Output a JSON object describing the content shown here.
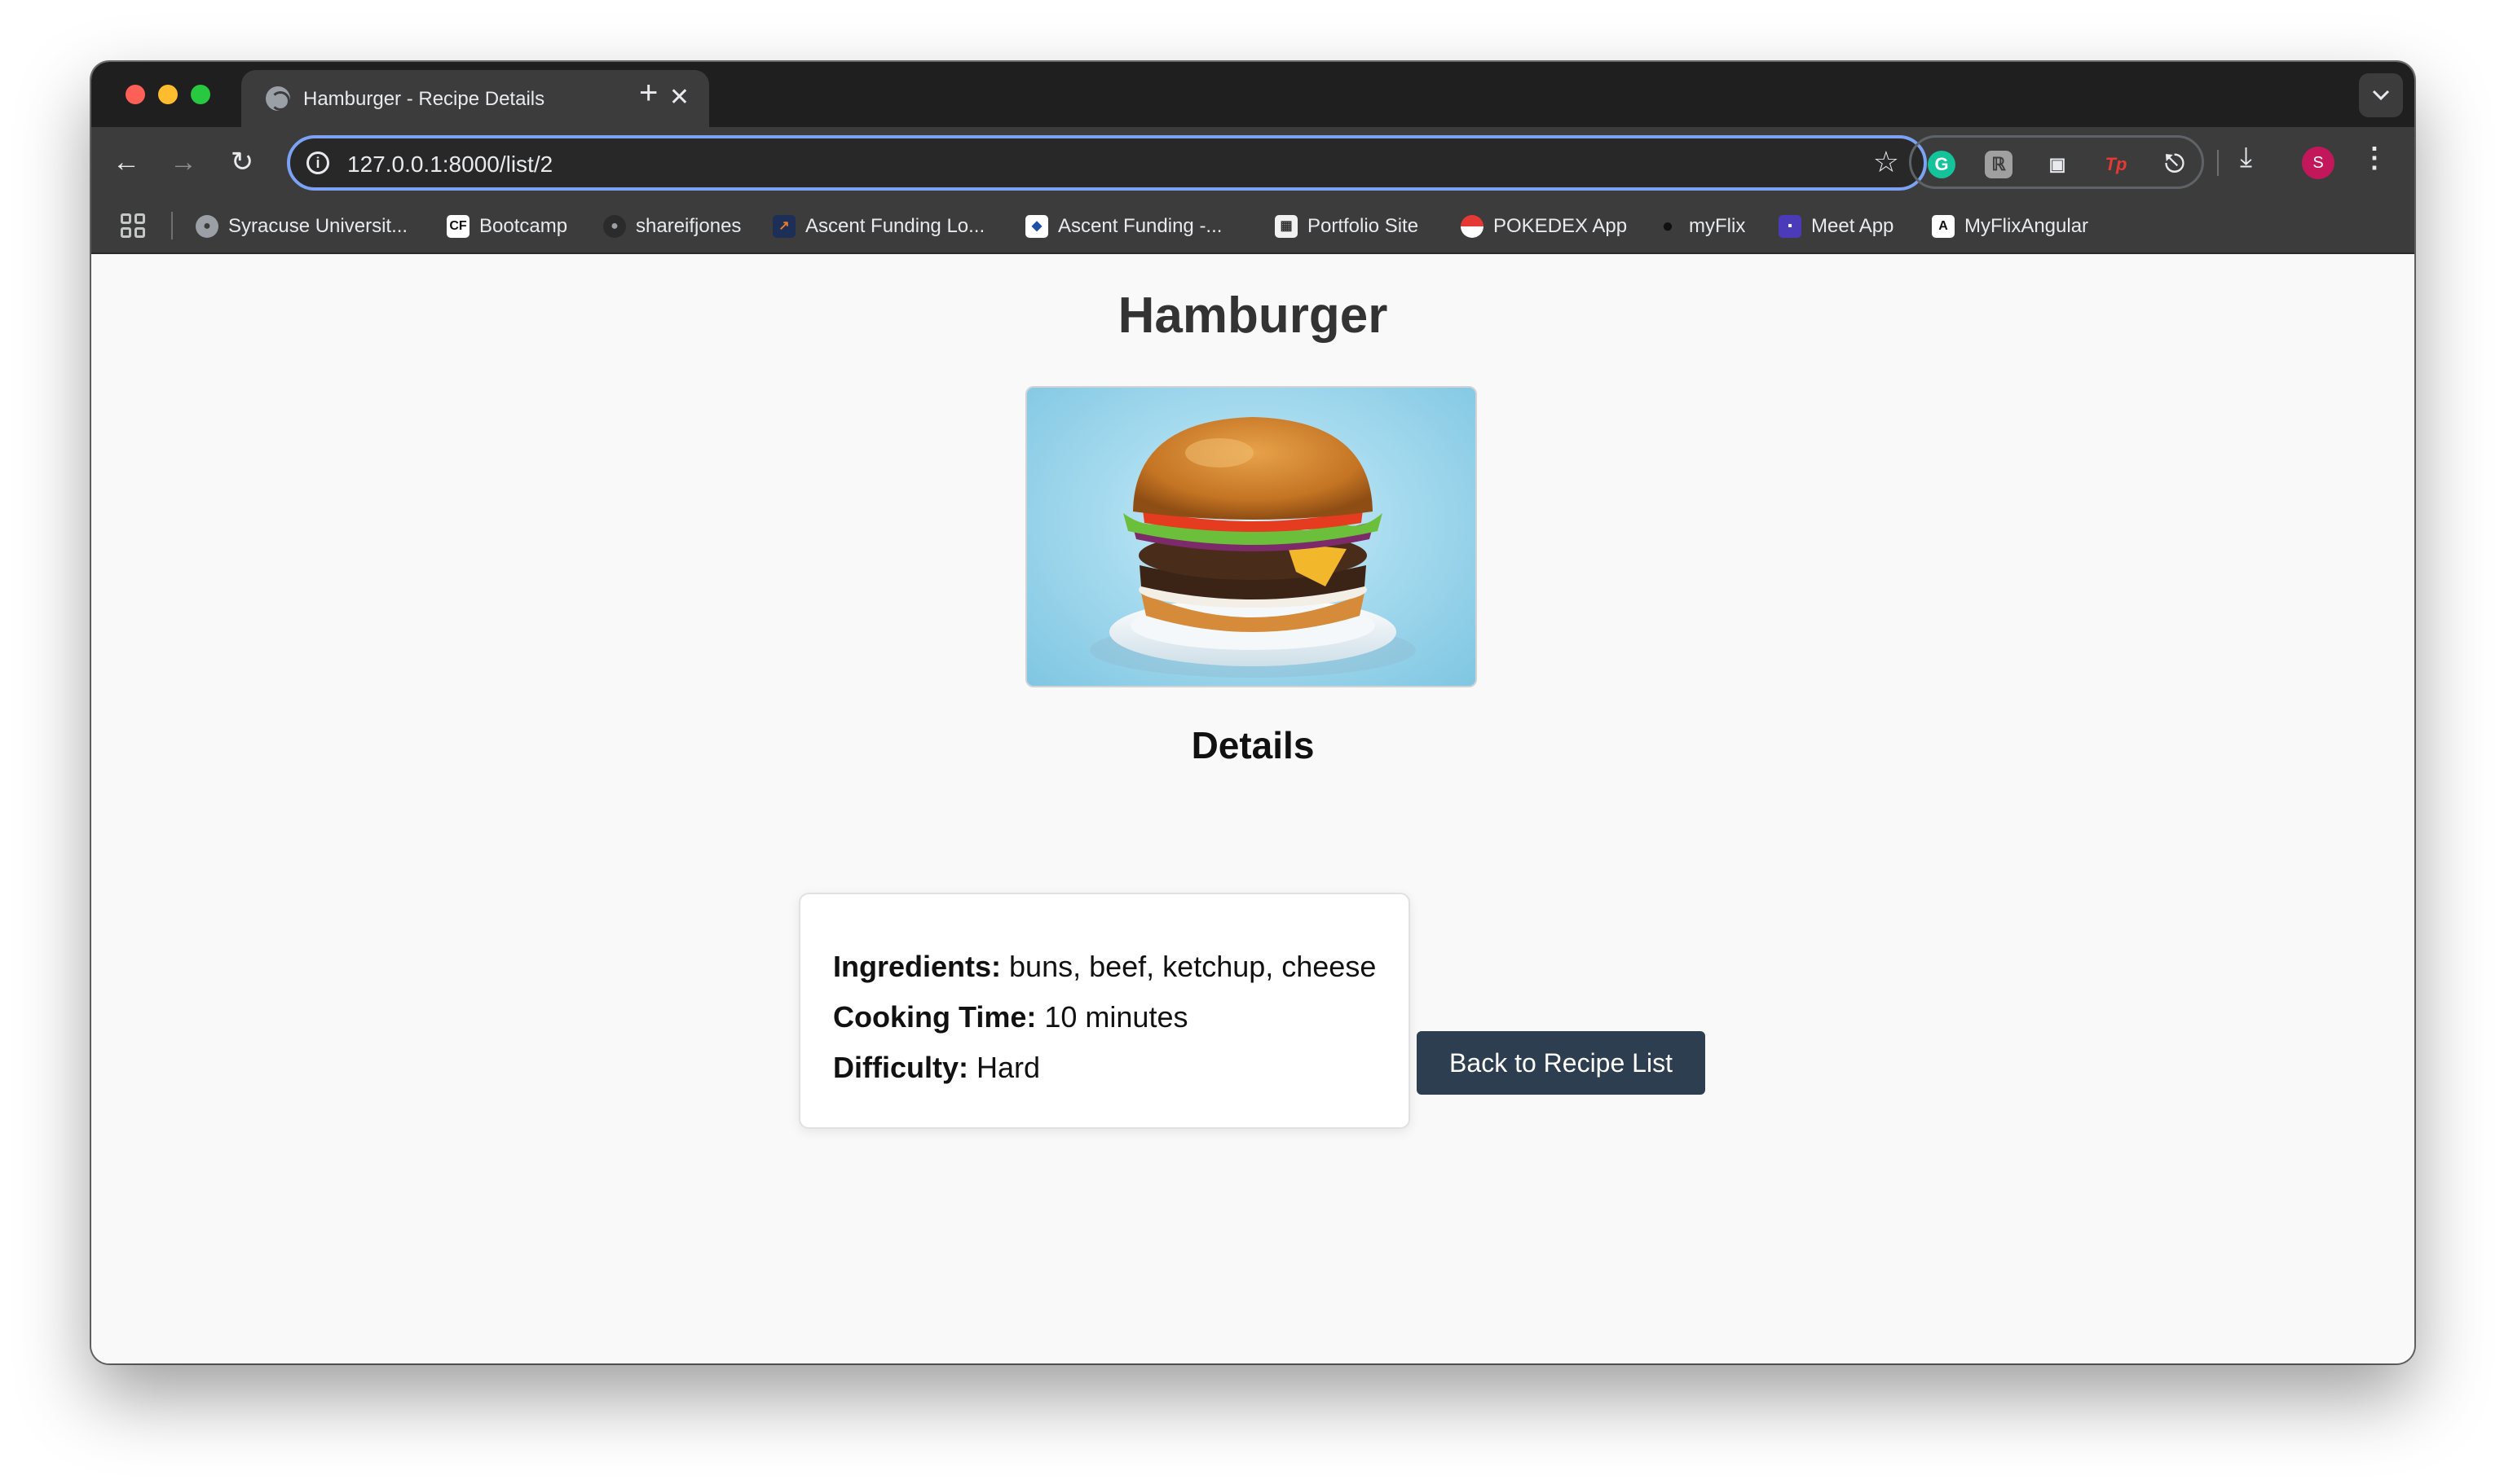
{
  "browser": {
    "tab_title": "Hamburger - Recipe Details",
    "tab_close": "✕",
    "new_tab": "+",
    "tab_search_icon": "chevron-down",
    "url": "127.0.0.1:8000/list/2",
    "avatar_letter": "S",
    "extensions": [
      "grammarly",
      "extension",
      "extension",
      "tp",
      "extensions-puzzle"
    ],
    "bookmarks": [
      {
        "label": "Syracuse Universit...",
        "icon": "globe"
      },
      {
        "label": "Bootcamp",
        "icon": "cf-logo"
      },
      {
        "label": "shareifjones",
        "icon": "github"
      },
      {
        "label": "Ascent Funding Lo...",
        "icon": "ascent"
      },
      {
        "label": "Ascent Funding -...",
        "icon": "ascent-shield"
      },
      {
        "label": "Portfolio Site",
        "icon": "portfolio"
      },
      {
        "label": "POKEDEX App",
        "icon": "pokeball"
      },
      {
        "label": "myFlix",
        "icon": "myflix"
      },
      {
        "label": "Meet App",
        "icon": "meet"
      },
      {
        "label": "MyFlixAngular",
        "icon": "angular"
      }
    ]
  },
  "page": {
    "title": "Hamburger",
    "details_heading": "Details",
    "ingredients_label": "Ingredients:",
    "ingredients_value": "buns, beef, ketchup, cheese",
    "cooking_time_label": "Cooking Time:",
    "cooking_time_value": "10 minutes",
    "difficulty_label": "Difficulty:",
    "difficulty_value": "Hard",
    "back_button": "Back to Recipe List"
  },
  "colors": {
    "button": "#2c3e50",
    "omnibox_focus": "#7ca2f4"
  }
}
